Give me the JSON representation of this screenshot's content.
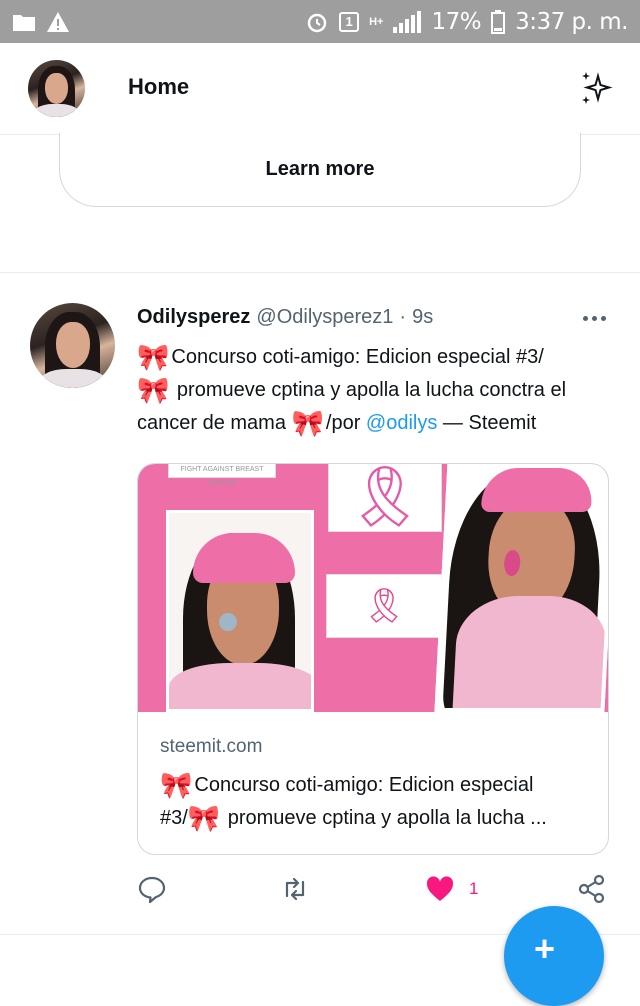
{
  "status_bar": {
    "battery": "17%",
    "time": "3:37 p. m.",
    "sim_badge": "1",
    "network": "H+",
    "icons": [
      "folder-icon",
      "warning-icon",
      "alarm-icon",
      "sim-icon",
      "signal-icon",
      "battery-icon"
    ]
  },
  "header": {
    "title": "Home",
    "icons": [
      "avatar",
      "sparkle-icon"
    ]
  },
  "promo": {
    "learn_more_label": "Learn more"
  },
  "tweet": {
    "name": "Odilysperez",
    "handle": "@Odilysperez1",
    "separator": "·",
    "time": "9s",
    "bow_emoji": "🎀",
    "text_line1": "Concurso coti-amigo: Edicion especial #3/",
    "text_line2": " promueve cptina y apolla la lucha conctra el cancer de mama ",
    "text_line3": "/por ",
    "mention": "@odilys",
    "text_tail": " — Steemit",
    "card": {
      "banner_text": "FIGHT AGAINST BREAST CANCER",
      "domain": "steemit.com",
      "title_line1": "Concurso coti-amigo: Edicion especial",
      "title_line2": "#3/",
      "title_line3": " promueve cptina y apolla la lucha ..."
    },
    "actions": {
      "like_count": "1",
      "liked": true,
      "icons": [
        "reply-icon",
        "retweet-icon",
        "heart-icon",
        "share-icon"
      ]
    }
  },
  "fab": {
    "icon": "compose-icon",
    "glyph": "+"
  },
  "colors": {
    "accent": "#1d9bf0",
    "like": "#f91880",
    "text_primary": "#0f1419",
    "text_secondary": "#536471",
    "status_bar": "#9e9e9e",
    "card_image_pink": "#ee6ea7"
  }
}
